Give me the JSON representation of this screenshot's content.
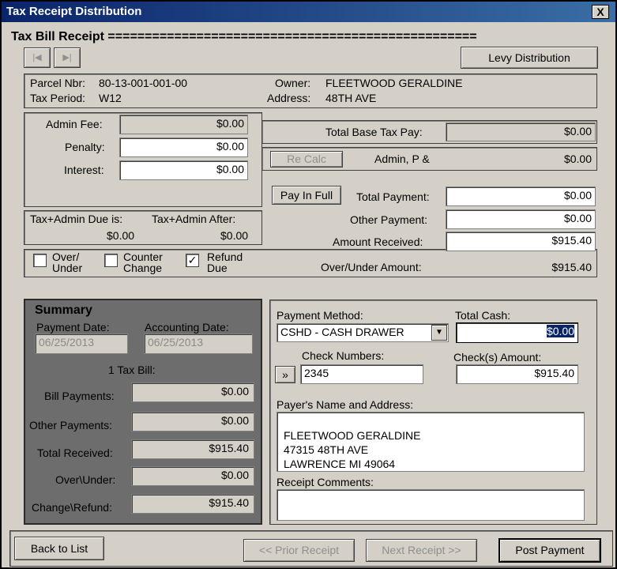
{
  "window": {
    "title": "Tax Receipt Distribution",
    "close": "X"
  },
  "section": {
    "title": "Tax Bill Receipt =================================================="
  },
  "nav": {
    "first": "|◀",
    "last": "▶|",
    "levy": "Levy Distribution"
  },
  "parcel": {
    "nbr_label": "Parcel Nbr:",
    "nbr": "80-13-001-001-00",
    "period_label": "Tax Period:",
    "period": "W12",
    "owner_label": "Owner:",
    "owner": "FLEETWOOD GERALDINE",
    "address_label": "Address:",
    "address": "48TH AVE"
  },
  "fees": {
    "admin_label": "Admin Fee:",
    "admin": "$0.00",
    "penalty_label": "Penalty:",
    "penalty": "$0.00",
    "interest_label": "Interest:",
    "interest": "$0.00"
  },
  "due": {
    "is_label": "Tax+Admin Due is:",
    "is_value": "$0.00",
    "after_label": "Tax+Admin After:",
    "after_value": "$0.00"
  },
  "checks": {
    "over_under": "Over/ Under",
    "over_under_checked": false,
    "counter_change": "Counter Change",
    "counter_change_checked": false,
    "refund_due": "Refund Due",
    "refund_due_checked": true
  },
  "totals": {
    "base_label": "Total Base Tax Pay:",
    "base": "$0.00",
    "recalc": "Re Calc",
    "admin_p_label": "Admin, P &",
    "admin_p": "$0.00",
    "pay_in_full": "Pay In Full",
    "total_payment_label": "Total Payment:",
    "total_payment": "$0.00",
    "other_payment_label": "Other Payment:",
    "other_payment": "$0.00",
    "amount_received_label": "Amount Received:",
    "amount_received": "$915.40",
    "over_under_label": "Over/Under Amount:",
    "over_under": "$915.40"
  },
  "summary": {
    "title": "Summary",
    "payment_date_label": "Payment Date:",
    "payment_date": "06/25/2013",
    "accounting_date_label": "Accounting Date:",
    "accounting_date": "06/25/2013",
    "tax_bill": "1 Tax Bill:",
    "bill_payments_label": "Bill Payments:",
    "bill_payments": "$0.00",
    "other_payments_label": "Other Payments:",
    "other_payments": "$0.00",
    "total_received_label": "Total Received:",
    "total_received": "$915.40",
    "over_under_label": "Over\\Under:",
    "over_under": "$0.00",
    "change_refund_label": "Change\\Refund:",
    "change_refund": "$915.40"
  },
  "payment": {
    "method_label": "Payment Method:",
    "method": "CSHD - CASH DRAWER",
    "total_cash_label": "Total Cash:",
    "total_cash": "$0.00",
    "check_numbers_label": "Check Numbers:",
    "check_numbers": "2345",
    "check_btn": "»",
    "checks_amount_label": "Check(s) Amount:",
    "checks_amount": "$915.40",
    "payer_label": "Payer's Name and Address:",
    "payer_line1": "FLEETWOOD GERALDINE",
    "payer_line2": "47315 48TH AVE",
    "payer_line3": "LAWRENCE MI 49064",
    "comments_label": "Receipt Comments:"
  },
  "footer": {
    "back": "Back to List",
    "prior": "<< Prior Receipt",
    "next": "Next Receipt >>",
    "post": "Post Payment"
  }
}
